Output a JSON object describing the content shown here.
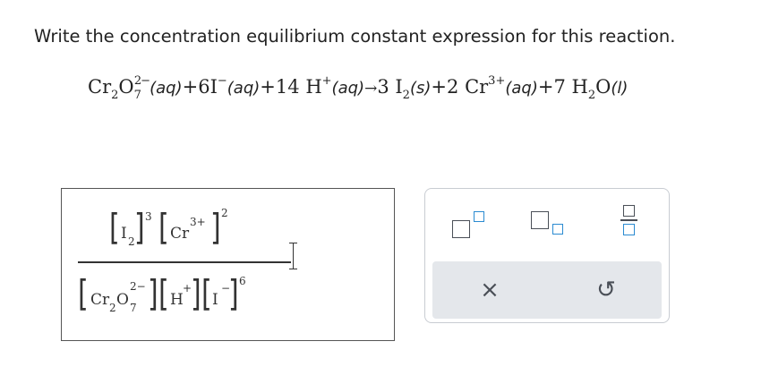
{
  "prompt": "Write the concentration equilibrium constant expression for this reaction.",
  "reaction": {
    "r1": "Cr",
    "r1_sub1": "2",
    "r1_o": "O",
    "r1_sub2": "7",
    "r1_charge": "2−",
    "r1_state": "(aq)",
    "plus": "+",
    "r2_coef": "6",
    "r2": "I",
    "r2_charge": "−",
    "r2_state": "(aq)",
    "r3_coef": "14",
    "r3": "H",
    "r3_charge": "+",
    "r3_state": "(aq)",
    "arrow": "→",
    "p1_coef": "3",
    "p1": "I",
    "p1_sub": "2",
    "p1_state": "(s)",
    "p2_coef": "2",
    "p2": "Cr",
    "p2_charge": "3+",
    "p2_state": "(aq)",
    "p3_coef": "7",
    "p3_h": "H",
    "p3_sub": "2",
    "p3_o": "O",
    "p3_state": "(l)"
  },
  "answer": {
    "num_i": "I",
    "num_i_sub": "2",
    "num_i_exp": "3",
    "num_cr": "Cr",
    "num_cr_charge": "3+",
    "num_cr_exp": "2",
    "den_cr": "Cr",
    "den_cr_sub1": "2",
    "den_o": "O",
    "den_o_sub": "7",
    "den_cr_charge": "2−",
    "den_h": "H",
    "den_h_charge": "+",
    "den_i": "I",
    "den_i_charge": "−",
    "den_exp": "6"
  },
  "palette": {
    "tools": [
      "superscript-box-icon",
      "subscript-box-icon",
      "fraction-box-icon"
    ],
    "clear_icon": "×",
    "undo_icon": "↺",
    "accent": "#2b8bd1"
  }
}
